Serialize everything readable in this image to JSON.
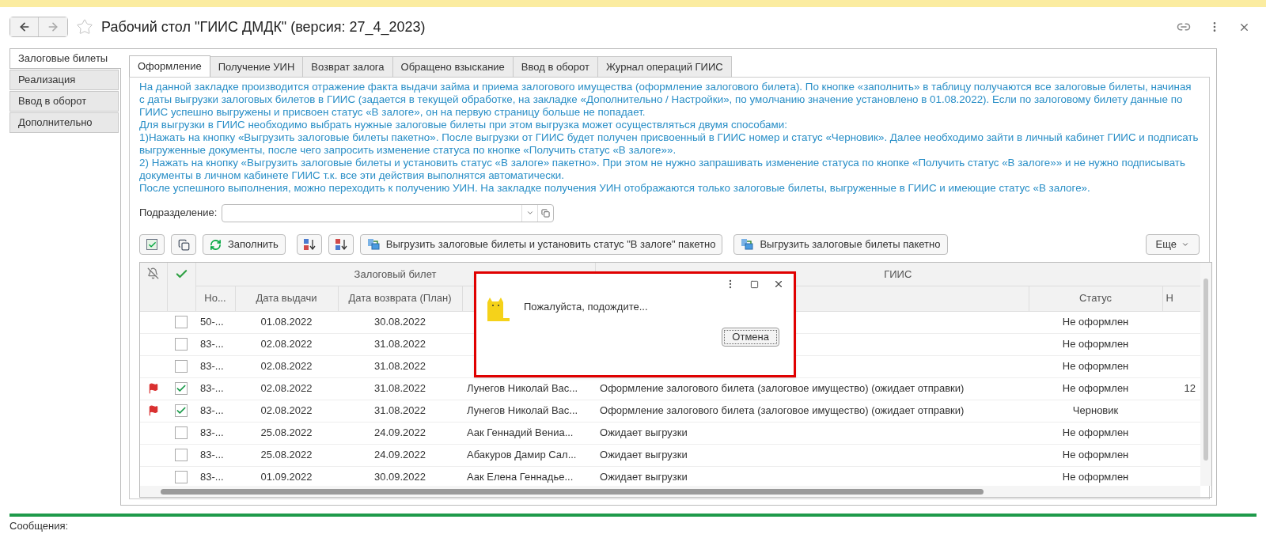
{
  "window": {
    "title": "Рабочий стол \"ГИИС ДМДК\" (версия: 27_4_2023)"
  },
  "side_tabs": [
    {
      "label": "Залоговые билеты",
      "selected": true
    },
    {
      "label": "Реализация",
      "selected": false
    },
    {
      "label": "Ввод в оборот",
      "selected": false
    },
    {
      "label": "Дополнительно",
      "selected": false
    }
  ],
  "tabs": [
    {
      "label": "Оформление",
      "selected": true
    },
    {
      "label": "Получение УИН",
      "selected": false
    },
    {
      "label": "Возврат залога",
      "selected": false
    },
    {
      "label": "Обращено взыскание",
      "selected": false
    },
    {
      "label": "Ввод в оборот",
      "selected": false
    },
    {
      "label": "Журнал операций ГИИС",
      "selected": false
    }
  ],
  "info_paragraphs": [
    "На данной закладке производится отражение факта выдачи займа и приема залогового имущества (оформление залогового билета). По кнопке «заполнить» в таблицу получаются все залоговые билеты, начиная с даты выгрузки залоговых билетов в ГИИС (задается в текущей обработке, на закладке «Дополнительно / Настройки», по умолчанию значение установлено в 01.08.2022). Если по залоговому билету данные по ГИИС успешно выгружены и присвоен статус «В залоге», он на первую страницу больше не попадает.",
    "Для выгрузки в ГИИС необходимо выбрать нужные залоговые билеты при этом выгрузка может осуществляться двумя способами:",
    "1)Нажать на кнопку «Выгрузить залоговые билеты пакетно». После выгрузки от ГИИС будет получен присвоенный в ГИИС номер и статус «Черновик». Далее необходимо зайти в личный кабинет ГИИС и подписать выгруженные документы, после чего запросить изменение статуса по кнопке «Получить статус «В залоге»».",
    "2) Нажать на кнопку «Выгрузить залоговые билеты и установить статус «В залоге» пакетно».  При этом не нужно запрашивать изменение статуса по кнопке «Получить статус «В залоге»» и не нужно подписывать документы в личном кабинете ГИИС т.к. все эти действия выполнятся автоматически.",
    "После успешного выполнения, можно переходить к получению УИН. На закладке получения УИН отображаются только залоговые билеты, выгруженные в ГИИС и имеющие статус «В залоге»."
  ],
  "subdivision": {
    "label": "Подразделение:"
  },
  "toolbar": [
    {
      "kind": "check-all"
    },
    {
      "kind": "uncheck-all"
    },
    {
      "kind": "refresh",
      "label": "Заполнить"
    },
    {
      "kind": "sort-asc"
    },
    {
      "kind": "sort-desc"
    },
    {
      "kind": "upload",
      "label": "Выгрузить залоговые билеты и установить статус \"В залоге\" пакетно"
    },
    {
      "kind": "upload",
      "label": "Выгрузить залоговые билеты пакетно"
    },
    {
      "kind": "more",
      "label": "Еще"
    }
  ],
  "table": {
    "groups": [
      "Залоговый билет",
      "ГИИС"
    ],
    "columns": [
      "Но...",
      "Дата выдачи",
      "Дата возврата (План)",
      "",
      "",
      "Статус",
      "Н"
    ],
    "rows": [
      {
        "flagged": false,
        "checked": false,
        "cells": [
          "50-...",
          "01.08.2022",
          "30.08.2022",
          "",
          "",
          "Не оформлен",
          ""
        ]
      },
      {
        "flagged": false,
        "checked": false,
        "cells": [
          "83-...",
          "02.08.2022",
          "31.08.2022",
          "",
          "",
          "Не оформлен",
          ""
        ]
      },
      {
        "flagged": false,
        "checked": false,
        "cells": [
          "83-...",
          "02.08.2022",
          "31.08.2022",
          "",
          "",
          "Не оформлен",
          ""
        ]
      },
      {
        "flagged": true,
        "checked": true,
        "cells": [
          "83-...",
          "02.08.2022",
          "31.08.2022",
          "Лунегов Николай Вас...",
          "Оформление залогового билета (залоговое имущество) (ожидает отправки)",
          "Не оформлен",
          "12"
        ]
      },
      {
        "flagged": true,
        "checked": true,
        "cells": [
          "83-...",
          "02.08.2022",
          "31.08.2022",
          "Лунегов Николай Вас...",
          "Оформление залогового билета (залоговое имущество) (ожидает отправки)",
          "Черновик",
          ""
        ]
      },
      {
        "flagged": false,
        "checked": false,
        "cells": [
          "83-...",
          "25.08.2022",
          "24.09.2022",
          "Аак Геннадий Вениа...",
          "Ожидает выгрузки",
          "Не оформлен",
          ""
        ]
      },
      {
        "flagged": false,
        "checked": false,
        "cells": [
          "83-...",
          "25.08.2022",
          "24.09.2022",
          "Абакуров Дамир Сал...",
          "Ожидает выгрузки",
          "Не оформлен",
          ""
        ]
      },
      {
        "flagged": false,
        "checked": false,
        "cells": [
          "83-...",
          "01.09.2022",
          "30.09.2022",
          "Аак Елена Геннадье...",
          "Ожидает выгрузки",
          "Не оформлен",
          ""
        ]
      }
    ]
  },
  "dialog": {
    "message": "Пожалуйста, подождите...",
    "cancel": "Отмена"
  },
  "messages_label": "Сообщения:"
}
